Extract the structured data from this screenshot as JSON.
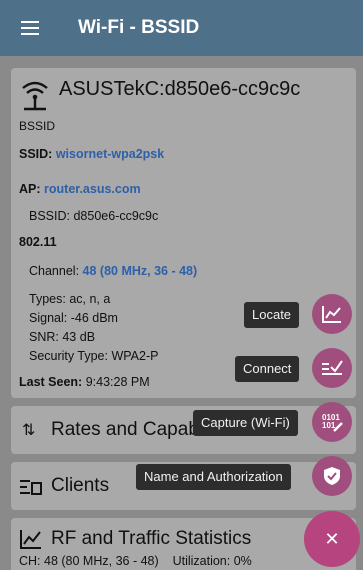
{
  "appbar": {
    "title": "Wi-Fi - BSSID"
  },
  "bssid_card": {
    "title": "ASUSTekC:d850e6-cc9c9c",
    "subtitle": "BSSID",
    "ssid_label": "SSID:",
    "ssid_value": "wisornet-wpa2psk",
    "ap_label": "AP:",
    "ap_value": "router.asus.com",
    "bssid_line_label": "BSSID:",
    "bssid_line_value": "d850e6-cc9c9c",
    "standard": "802.11",
    "channel_label": "Channel:",
    "channel_value": "48 (80 MHz, 36 - 48)",
    "types_label": "Types:",
    "types_value": "ac, n, a",
    "signal_label": "Signal:",
    "signal_value": "-46 dBm",
    "snr_label": "SNR:",
    "snr_value": "43 dB",
    "security_label": "Security Type:",
    "security_value": "WPA2-P",
    "last_seen_label": "Last Seen:",
    "last_seen_value": "9:43:28 PM"
  },
  "sections": {
    "rates": "Rates and Capabilities",
    "clients": "Clients",
    "rf": "RF and Traffic Statistics",
    "rf_channel_label": "CH:",
    "rf_channel_value": "48 (80 MHz, 36 - 48)",
    "rf_util_label": "Utilization:",
    "rf_util_value": "0%"
  },
  "fab_menu": {
    "locate": "Locate",
    "connect": "Connect",
    "capture": "Capture (Wi-Fi)",
    "name_auth": "Name and Authorization",
    "close_icon": "close-icon"
  },
  "colors": {
    "appbar": "#4f7089",
    "fab": "#a04e7e",
    "link": "#2e5fa8"
  }
}
